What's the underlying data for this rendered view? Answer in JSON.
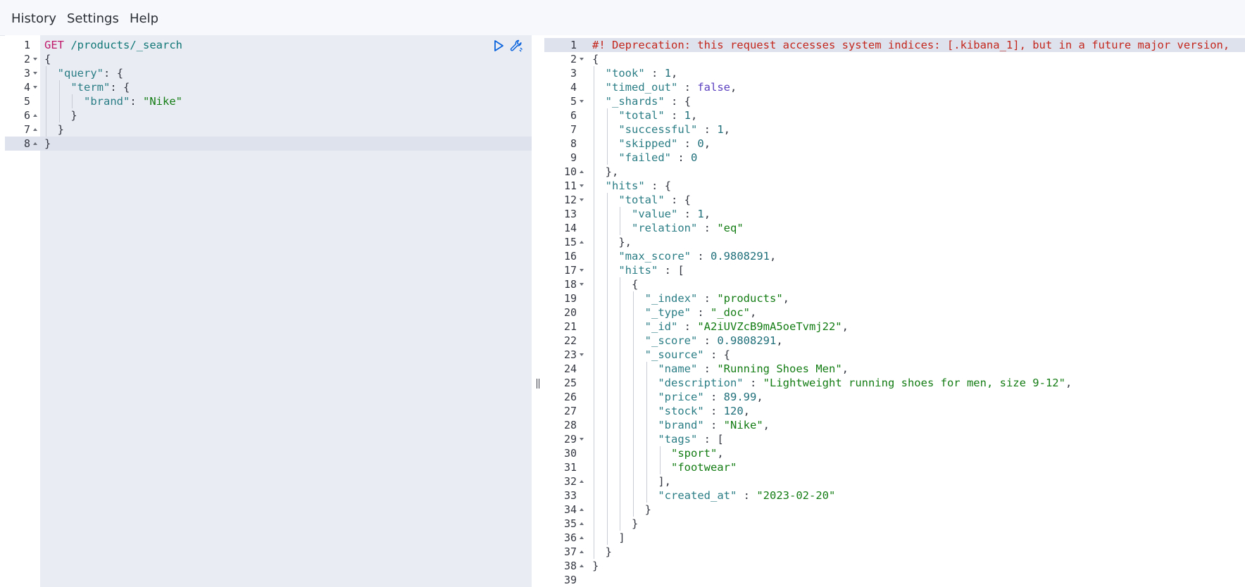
{
  "menu": {
    "items": [
      "History",
      "Settings",
      "Help"
    ]
  },
  "request": {
    "method": "GET",
    "path": "/products/_search",
    "lines": [
      "GET /products/_search",
      "{",
      "  \"query\": {",
      "    \"term\": {",
      "      \"brand\": \"Nike\"",
      "    }",
      "  }",
      "}"
    ],
    "fold_markers": [
      "",
      "open",
      "open",
      "open",
      "",
      "closed",
      "closed",
      "closed"
    ],
    "actions": {
      "run_icon": "play-icon",
      "settings_icon": "wrench-icon"
    }
  },
  "response": {
    "lines": [
      "#! Deprecation: this request accesses system indices: [.kibana_1], but in a future major version,",
      "{",
      "  \"took\" : 1,",
      "  \"timed_out\" : false,",
      "  \"_shards\" : {",
      "    \"total\" : 1,",
      "    \"successful\" : 1,",
      "    \"skipped\" : 0,",
      "    \"failed\" : 0",
      "  },",
      "  \"hits\" : {",
      "    \"total\" : {",
      "      \"value\" : 1,",
      "      \"relation\" : \"eq\"",
      "    },",
      "    \"max_score\" : 0.9808291,",
      "    \"hits\" : [",
      "      {",
      "        \"_index\" : \"products\",",
      "        \"_type\" : \"_doc\",",
      "        \"_id\" : \"A2iUVZcB9mA5oeTvmj22\",",
      "        \"_score\" : 0.9808291,",
      "        \"_source\" : {",
      "          \"name\" : \"Running Shoes Men\",",
      "          \"description\" : \"Lightweight running shoes for men, size 9-12\",",
      "          \"price\" : 89.99,",
      "          \"stock\" : 120,",
      "          \"brand\" : \"Nike\",",
      "          \"tags\" : [",
      "            \"sport\",",
      "            \"footwear\"",
      "          ],",
      "          \"created_at\" : \"2023-02-20\"",
      "        }",
      "      }",
      "    ]",
      "  }",
      "}",
      ""
    ],
    "fold_markers": [
      "",
      "open",
      "",
      "",
      "open",
      "",
      "",
      "",
      "",
      "closed",
      "open",
      "open",
      "",
      "",
      "closed",
      "",
      "open",
      "open",
      "",
      "",
      "",
      "",
      "open",
      "",
      "",
      "",
      "",
      "",
      "open",
      "",
      "",
      "closed",
      "",
      "closed",
      "closed",
      "closed",
      "closed",
      "closed",
      ""
    ]
  },
  "divider": {
    "icon": "drag-handle-icon"
  }
}
